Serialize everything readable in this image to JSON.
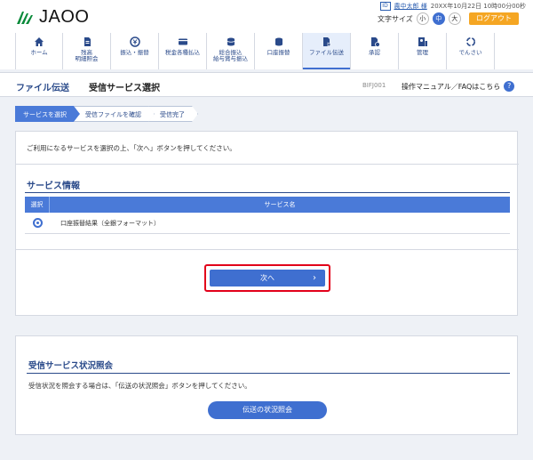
{
  "header": {
    "logo_text": "JAOO",
    "user_icon_label": "ID",
    "user_name": "農中太郎 様",
    "datetime": "20XX年10月22日 10時00分00秒",
    "font_size_label": "文字サイズ",
    "font_sizes": [
      "小",
      "中",
      "大"
    ],
    "font_size_selected": "中",
    "logout_label": "ログアウト"
  },
  "nav": {
    "items": [
      {
        "label": "ホーム",
        "icon": "home-icon"
      },
      {
        "label": "残高\n明細照会",
        "icon": "document-icon"
      },
      {
        "label": "振込・振替",
        "icon": "yen-transfer-icon"
      },
      {
        "label": "税金各種払込",
        "icon": "card-icon"
      },
      {
        "label": "総合振込\n給与賞与振込",
        "icon": "coins-icon"
      },
      {
        "label": "口座振替",
        "icon": "coin-stack-icon"
      },
      {
        "label": "ファイル伝送",
        "icon": "file-transfer-icon"
      },
      {
        "label": "承認",
        "icon": "approve-icon"
      },
      {
        "label": "管理",
        "icon": "manage-icon"
      },
      {
        "label": "でんさい",
        "icon": "densai-icon"
      }
    ],
    "active": "ファイル伝送"
  },
  "titlebar": {
    "section": "ファイル伝送",
    "title": "受信サービス選択",
    "screen_code": "BIFJ001",
    "help_text": "操作マニュアル／FAQはこちら",
    "help_icon": "?"
  },
  "steps": [
    "サービスを選択",
    "受信ファイルを確認",
    "受信完了"
  ],
  "service_panel": {
    "intro": "ご利用になるサービスを選択の上、「次へ」ボタンを押してください。",
    "heading": "サービス情報",
    "table": {
      "columns": [
        "選択",
        "サービス名"
      ],
      "rows": [
        {
          "selected": true,
          "name": "口座振替結果（全銀フォーマット）"
        }
      ]
    },
    "next_label": "次へ",
    "next_arrow": "›"
  },
  "status_panel": {
    "heading": "受信サービス状況照会",
    "text": "受信状況を照会する場合は、「伝送の状況照会」ボタンを押してください。",
    "button_label": "伝送の状況照会"
  },
  "colors": {
    "accent": "#3f6fd0",
    "heading": "#2a4a8a",
    "logout": "#f5a623",
    "highlight": "#e2001a"
  }
}
